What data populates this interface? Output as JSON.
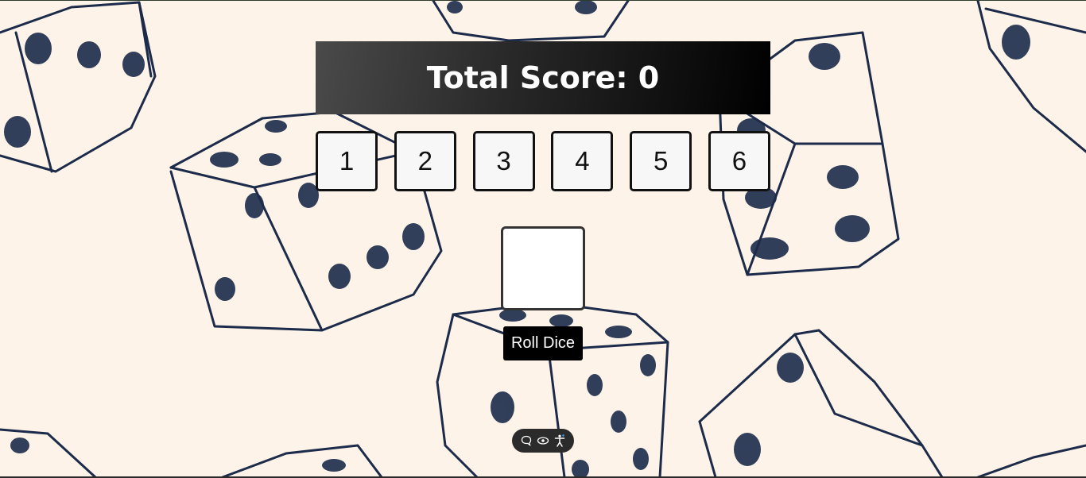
{
  "scoreboard": {
    "label": "Total Score: 0"
  },
  "number_buttons": [
    "1",
    "2",
    "3",
    "4",
    "5",
    "6"
  ],
  "roll_button": {
    "label": "Roll Dice"
  },
  "toolbar": {
    "icons": [
      "chat-bubble-icon",
      "eye-icon",
      "accessibility-icon"
    ]
  },
  "colors": {
    "background": "#fdf3e8",
    "sketch_ink": "#1c2b4a",
    "scoreboard_dark": "#000000",
    "button_bg": "#f7f7f7"
  }
}
